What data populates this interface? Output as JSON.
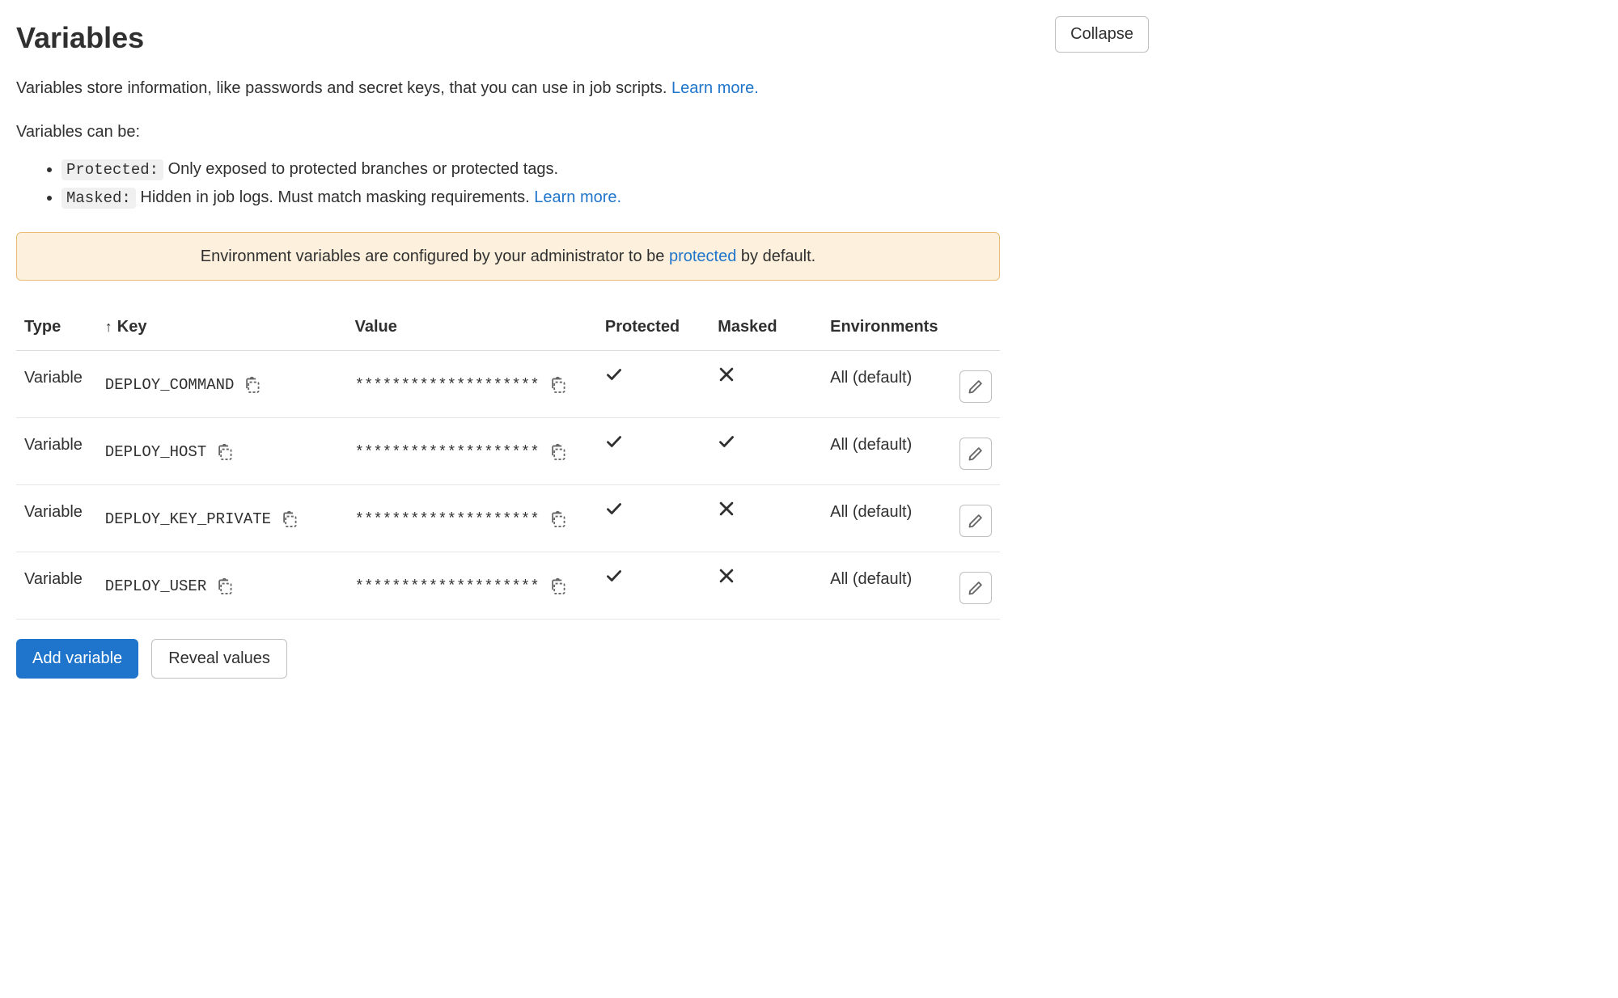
{
  "header": {
    "title": "Variables",
    "collapse_label": "Collapse"
  },
  "intro": {
    "text": "Variables store information, like passwords and secret keys, that you can use in job scripts. ",
    "link": "Learn more."
  },
  "sub_intro": "Variables can be:",
  "bullets": {
    "protected": {
      "pill": "Protected:",
      "text": " Only exposed to protected branches or protected tags."
    },
    "masked": {
      "pill": "Masked:",
      "text": " Hidden in job logs. Must match masking requirements. ",
      "link": "Learn more."
    }
  },
  "alert": {
    "prefix": "Environment variables are configured by your administrator to be ",
    "link": "protected",
    "suffix": " by default."
  },
  "table": {
    "headers": {
      "type": "Type",
      "key": "Key",
      "value": "Value",
      "protected": "Protected",
      "masked": "Masked",
      "environments": "Environments"
    },
    "masked_placeholder": "********************",
    "rows": [
      {
        "type": "Variable",
        "key": "DEPLOY_COMMAND",
        "protected": true,
        "masked": false,
        "env": "All (default)"
      },
      {
        "type": "Variable",
        "key": "DEPLOY_HOST",
        "protected": true,
        "masked": true,
        "env": "All (default)"
      },
      {
        "type": "Variable",
        "key": "DEPLOY_KEY_PRIVATE",
        "protected": true,
        "masked": false,
        "env": "All (default)"
      },
      {
        "type": "Variable",
        "key": "DEPLOY_USER",
        "protected": true,
        "masked": false,
        "env": "All (default)"
      }
    ]
  },
  "footer": {
    "add_label": "Add variable",
    "reveal_label": "Reveal values"
  }
}
